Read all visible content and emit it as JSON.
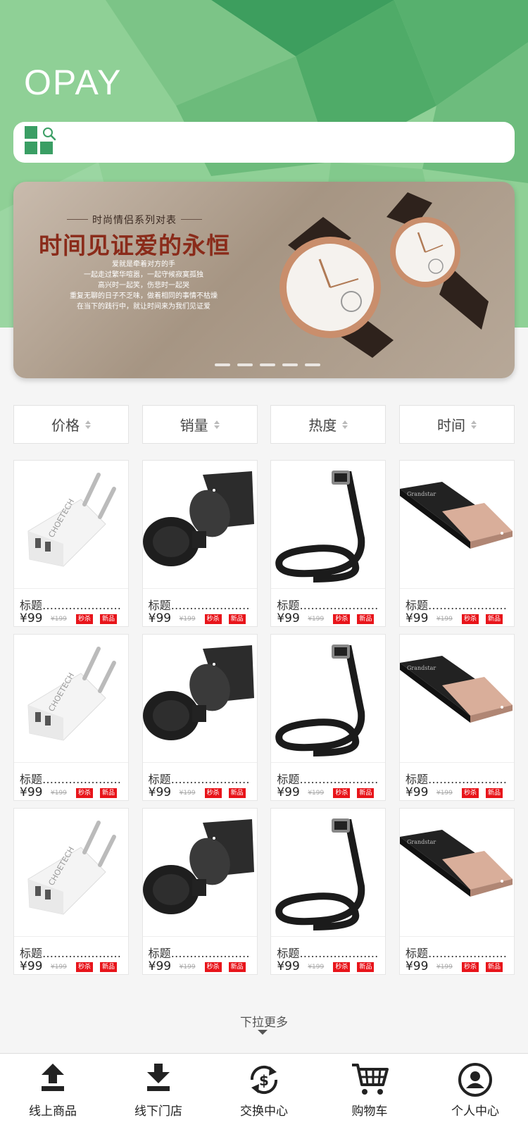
{
  "header": {
    "brand": "OPAY",
    "search": {
      "placeholder": ""
    }
  },
  "banner": {
    "subtitle": "时尚情侣系列对表",
    "title": "时间见证爱的永恒",
    "lines": [
      "爱就是牵着对方的手",
      "一起走过繁华喧嚣，一起守候寂寞孤独",
      "高兴时一起笑，伤悲时一起哭",
      "重复无聊的日子不乏味，做着相同的事情不枯燥",
      "在当下的践行中，就让时间来为我们见证爱"
    ],
    "dots": 5
  },
  "sort_tabs": [
    {
      "label": "价格"
    },
    {
      "label": "销量"
    },
    {
      "label": "热度"
    },
    {
      "label": "时间"
    }
  ],
  "products": [
    {
      "kind": "charger",
      "title": "标题…………………",
      "price": "¥99",
      "old_price": "¥199",
      "tag1": "秒杀",
      "tag2": "新品"
    },
    {
      "kind": "magnet",
      "title": "标题…………………",
      "price": "¥99",
      "old_price": "¥199",
      "tag1": "秒杀",
      "tag2": "新品"
    },
    {
      "kind": "belt",
      "title": "标题…………………",
      "price": "¥99",
      "old_price": "¥199",
      "tag1": "秒杀",
      "tag2": "新品"
    },
    {
      "kind": "powerbank",
      "title": "标题…………………",
      "price": "¥99",
      "old_price": "¥199",
      "tag1": "秒杀",
      "tag2": "新品"
    },
    {
      "kind": "charger",
      "title": "标题…………………",
      "price": "¥99",
      "old_price": "¥199",
      "tag1": "秒杀",
      "tag2": "新品"
    },
    {
      "kind": "magnet",
      "title": "标题…………………",
      "price": "¥99",
      "old_price": "¥199",
      "tag1": "秒杀",
      "tag2": "新品"
    },
    {
      "kind": "belt",
      "title": "标题…………………",
      "price": "¥99",
      "old_price": "¥199",
      "tag1": "秒杀",
      "tag2": "新品"
    },
    {
      "kind": "powerbank",
      "title": "标题…………………",
      "price": "¥99",
      "old_price": "¥199",
      "tag1": "秒杀",
      "tag2": "新品"
    },
    {
      "kind": "charger",
      "title": "标题…………………",
      "price": "¥99",
      "old_price": "¥199",
      "tag1": "秒杀",
      "tag2": "新品"
    },
    {
      "kind": "magnet",
      "title": "标题…………………",
      "price": "¥99",
      "old_price": "¥199",
      "tag1": "秒杀",
      "tag2": "新品"
    },
    {
      "kind": "belt",
      "title": "标题…………………",
      "price": "¥99",
      "old_price": "¥199",
      "tag1": "秒杀",
      "tag2": "新品"
    },
    {
      "kind": "powerbank",
      "title": "标题…………………",
      "price": "¥99",
      "old_price": "¥199",
      "tag1": "秒杀",
      "tag2": "新品"
    }
  ],
  "pull_more": "下拉更多",
  "tabbar": [
    {
      "label": "线上商品",
      "icon": "upload-icon"
    },
    {
      "label": "线下门店",
      "icon": "download-icon"
    },
    {
      "label": "交换中心",
      "icon": "exchange-icon"
    },
    {
      "label": "购物车",
      "icon": "cart-icon"
    },
    {
      "label": "个人中心",
      "icon": "user-icon"
    }
  ],
  "colors": {
    "brand_green": "#3a9e64",
    "header_green": "#8ecf94",
    "tag_red": "#e8141a"
  }
}
